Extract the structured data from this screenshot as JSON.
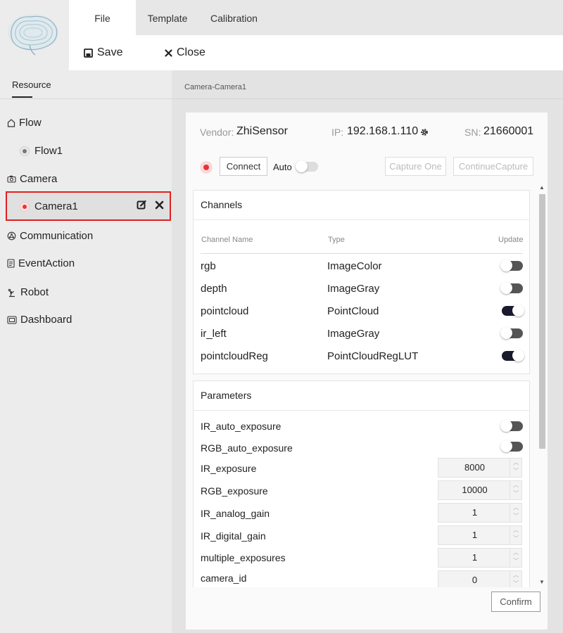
{
  "app": {
    "logo_text": ""
  },
  "menu": {
    "tabs": [
      "File",
      "Template",
      "Calibration"
    ],
    "active": "File"
  },
  "toolbar": {
    "save_label": "Save",
    "close_label": "Close"
  },
  "sidebar": {
    "tab_label": "Resource",
    "categories": [
      {
        "label": "Flow",
        "icon": "home-outline-icon"
      },
      {
        "label": "Camera",
        "icon": "camera-icon"
      },
      {
        "label": "Communication",
        "icon": "network-icon"
      },
      {
        "label": "EventAction",
        "icon": "document-icon"
      },
      {
        "label": "Robot",
        "icon": "robot-arm-icon"
      },
      {
        "label": "Dashboard",
        "icon": "dashboard-icon"
      }
    ],
    "flow_items": [
      {
        "label": "Flow1",
        "status": "idle"
      }
    ],
    "camera_items": [
      {
        "label": "Camera1",
        "status": "disconnected",
        "selected": true
      }
    ]
  },
  "main": {
    "breadcrumb": "Camera-Camera1",
    "vendor_label": "Vendor:",
    "vendor_value": "ZhiSensor",
    "ip_label": "IP:",
    "ip_value": "192.168.1.110",
    "sn_label": "SN:",
    "sn_value": "21660001",
    "connect_label": "Connect",
    "auto_label": "Auto",
    "auto_on": false,
    "capture_one_label": "Capture One",
    "continue_capture_label": "ContinueCapture",
    "confirm_label": "Confirm"
  },
  "channels": {
    "title": "Channels",
    "headers": [
      "Channel Name",
      "Type",
      "Update"
    ],
    "rows": [
      {
        "name": "rgb",
        "type": "ImageColor",
        "update": false
      },
      {
        "name": "depth",
        "type": "ImageGray",
        "update": false
      },
      {
        "name": "pointcloud",
        "type": "PointCloud",
        "update": true
      },
      {
        "name": "ir_left",
        "type": "ImageGray",
        "update": false
      },
      {
        "name": "pointcloudReg",
        "type": "PointCloudRegLUT",
        "update": true
      }
    ]
  },
  "parameters": {
    "title": "Parameters",
    "toggles": [
      {
        "name": "IR_auto_exposure",
        "value": false
      },
      {
        "name": "RGB_auto_exposure",
        "value": false
      }
    ],
    "numbers": [
      {
        "name": "IR_exposure",
        "value": "8000"
      },
      {
        "name": "RGB_exposure",
        "value": "10000"
      },
      {
        "name": "IR_analog_gain",
        "value": "1"
      },
      {
        "name": "IR_digital_gain",
        "value": "1"
      },
      {
        "name": "multiple_exposures",
        "value": "1"
      },
      {
        "name": "camera_id",
        "value": "0"
      }
    ]
  },
  "colors": {
    "accent_red": "#e02020",
    "status_red": "#e5333b",
    "toggle_on": "#1a1a2e",
    "toggle_off": "#555555"
  }
}
